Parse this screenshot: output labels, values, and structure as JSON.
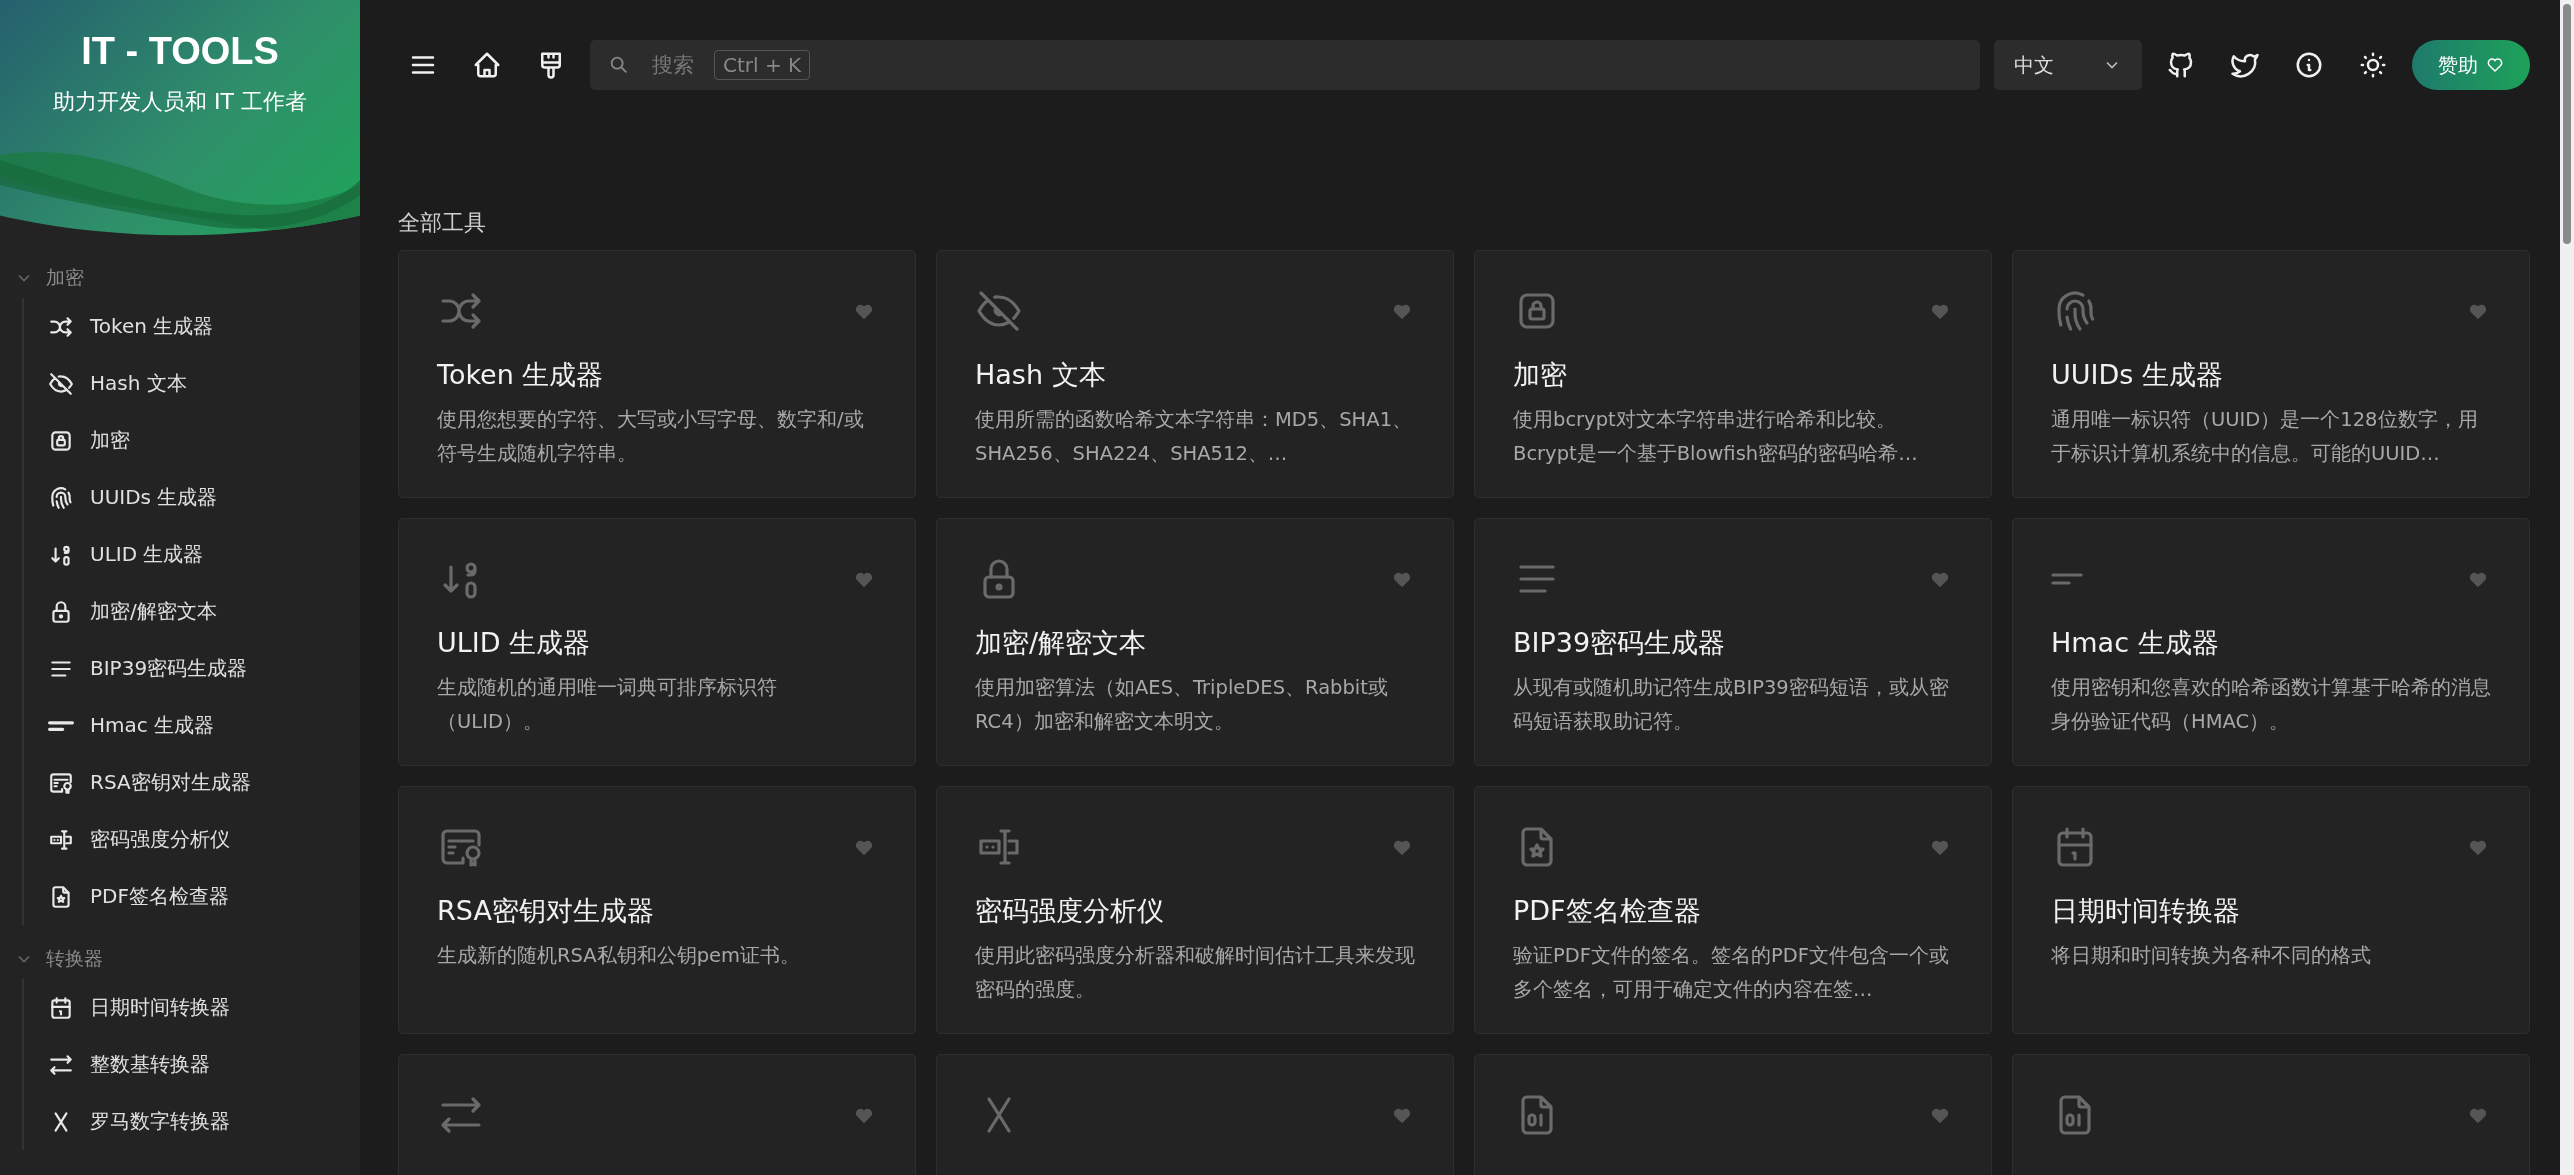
{
  "sidebar": {
    "logo_title": "IT - TOOLS",
    "logo_subtitle": "助力开发人员和 IT 工作者",
    "groups": [
      {
        "label": "加密",
        "expanded": true,
        "items": [
          "Token 生成器",
          "Hash 文本",
          "加密",
          "UUIDs 生成器",
          "ULID 生成器",
          "加密/解密文本",
          "BIP39密码生成器",
          "Hmac 生成器",
          "RSA密钥对生成器",
          "密码强度分析仪",
          "PDF签名检查器"
        ]
      },
      {
        "label": "转换器",
        "expanded": true,
        "items": [
          "日期时间转换器",
          "整数基转换器",
          "罗马数字转换器"
        ]
      }
    ]
  },
  "header": {
    "search": {
      "placeholder": "搜索",
      "shortcut": "Ctrl + K"
    },
    "language": "中文",
    "sponsor": "赞助"
  },
  "section_title": "全部工具",
  "tools": [
    {
      "title": "Token 生成器",
      "description": "使用您想要的字符、大写或小写字母、数字和/或符号生成随机字符串。"
    },
    {
      "title": "Hash 文本",
      "description": "使用所需的函数哈希文本字符串：MD5、SHA1、SHA256、SHA224、SHA512、…"
    },
    {
      "title": "加密",
      "description": "使用bcrypt对文本字符串进行哈希和比较。Bcrypt是一个基于Blowfish密码的密码哈希…"
    },
    {
      "title": "UUIDs 生成器",
      "description": "通用唯一标识符（UUID）是一个128位数字，用于标识计算机系统中的信息。可能的UUID…"
    },
    {
      "title": "ULID 生成器",
      "description": "生成随机的通用唯一词典可排序标识符（ULID）。"
    },
    {
      "title": "加密/解密文本",
      "description": "使用加密算法（如AES、TripleDES、Rabbit或RC4）加密和解密文本明文。"
    },
    {
      "title": "BIP39密码生成器",
      "description": "从现有或随机助记符生成BIP39密码短语，或从密码短语获取助记符。"
    },
    {
      "title": "Hmac 生成器",
      "description": "使用密钥和您喜欢的哈希函数计算基于哈希的消息身份验证代码（HMAC）。"
    },
    {
      "title": "RSA密钥对生成器",
      "description": "生成新的随机RSA私钥和公钥pem证书。"
    },
    {
      "title": "密码强度分析仪",
      "description": "使用此密码强度分析器和破解时间估计工具来发现密码的强度。"
    },
    {
      "title": "PDF签名检查器",
      "description": "验证PDF文件的签名。签名的PDF文件包含一个或多个签名，可用于确定文件的内容在签…"
    },
    {
      "title": "日期时间转换器",
      "description": "将日期和时间转换为各种不同的格式"
    },
    {
      "kind": "cut_off"
    },
    {
      "kind": "cut_off"
    },
    {
      "kind": "cut_off"
    },
    {
      "kind": "cut_off"
    }
  ]
}
